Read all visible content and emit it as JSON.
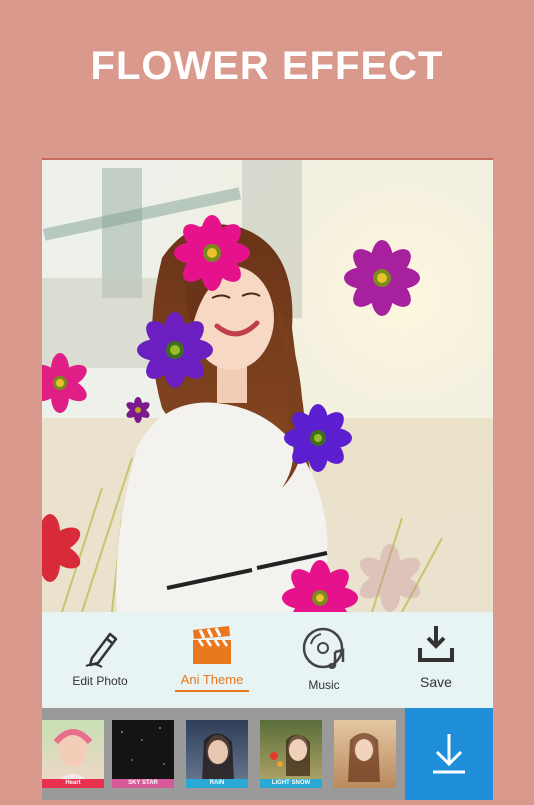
{
  "header": {
    "title": "FLOWER EFFECT"
  },
  "toolbar": {
    "edit_photo": "Edit Photo",
    "ani_theme": "Ani Theme",
    "music": "Music",
    "save": "Save"
  },
  "themes": [
    {
      "label": "Heart",
      "color": "#e8304f"
    },
    {
      "label": "SKY STAR",
      "color": "#d65a9a"
    },
    {
      "label": "RAIN",
      "color": "#2aa9d6"
    },
    {
      "label": "LIGHT SNOW",
      "color": "#2aa9d6"
    },
    {
      "label": "",
      "color": ""
    }
  ],
  "colors": {
    "background": "#d9998c",
    "accent": "#e8781e",
    "download": "#1e8fd8",
    "flower_pink": "#e6128c",
    "flower_purple": "#6b1fc1"
  },
  "icons": {
    "edit_photo": "pencil-icon",
    "ani_theme": "clapperboard-icon",
    "music": "music-disc-icon",
    "save": "download-tray-icon",
    "download_button": "download-arrow-icon"
  }
}
